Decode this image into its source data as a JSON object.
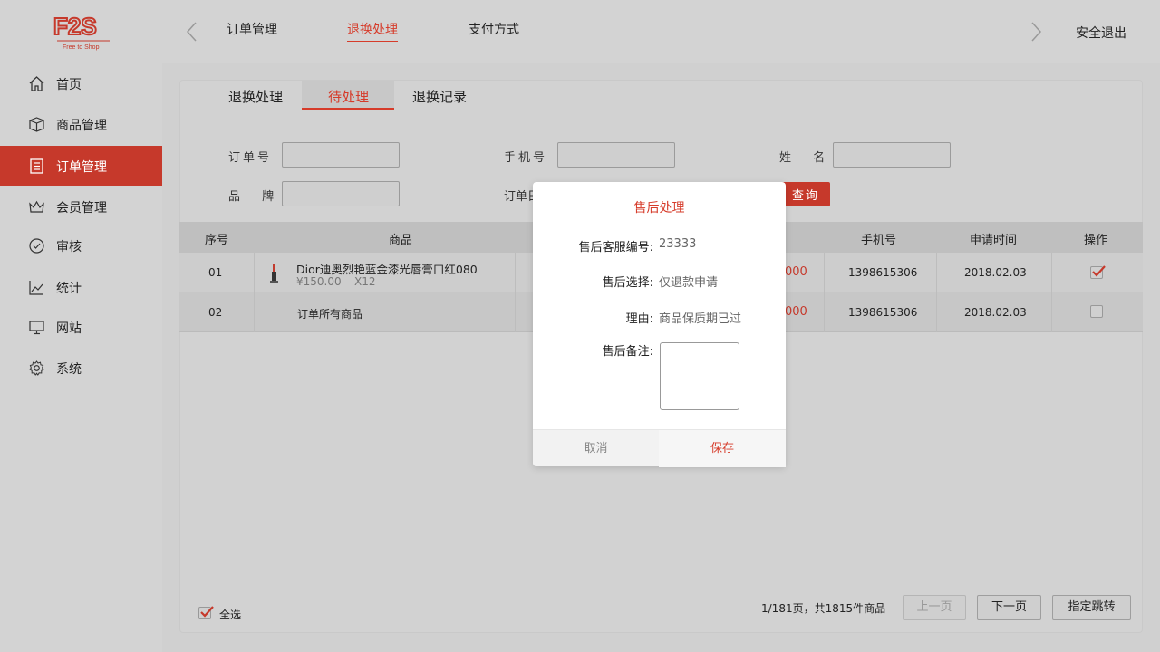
{
  "brand": {
    "logo_text": "F2S",
    "logo_subtitle": "Free to Shop",
    "accent": "#c6392b"
  },
  "topnav": {
    "tabs": [
      {
        "label": "订单管理"
      },
      {
        "label": "退换处理",
        "active": true
      },
      {
        "label": "支付方式"
      }
    ],
    "logout": "安全退出"
  },
  "sidebar": {
    "items": [
      {
        "label": "首页",
        "icon": "home-icon"
      },
      {
        "label": "商品管理",
        "icon": "box-icon"
      },
      {
        "label": "订单管理",
        "icon": "document-icon",
        "active": true
      },
      {
        "label": "会员管理",
        "icon": "crown-icon"
      },
      {
        "label": "审核",
        "icon": "check-circle-icon"
      },
      {
        "label": "统计",
        "icon": "line-chart-icon"
      },
      {
        "label": "网站",
        "icon": "monitor-icon"
      },
      {
        "label": "系统",
        "icon": "gear-icon"
      }
    ]
  },
  "subtabs": [
    {
      "label": "退换处理"
    },
    {
      "label": "待处理",
      "active": true
    },
    {
      "label": "退换记录"
    }
  ],
  "filters": {
    "order_no": "订单号",
    "phone": "手机号",
    "name": "姓 名",
    "brand": "品 牌",
    "order_date": "订单日",
    "query": "查询"
  },
  "table": {
    "headers": [
      "序号",
      "商品",
      "手机号",
      "申请时间",
      "操作"
    ],
    "rows": [
      {
        "no": "01",
        "product": "Dior迪奥烈艳蓝金漆光唇膏口红080",
        "price": "¥150.00",
        "qty": "X12",
        "amount": "000",
        "phone": "1398615306",
        "date": "2018.02.03",
        "checked": true
      },
      {
        "no": "02",
        "product": "订单所有商品",
        "amount": "000",
        "phone": "1398615306",
        "date": "2018.02.03",
        "checked": false
      }
    ]
  },
  "footer": {
    "select_all": "全选",
    "page_info": "1/181页，共1815件商品",
    "prev": "上一页",
    "next": "下一页",
    "jump": "指定跳转"
  },
  "modal": {
    "title": "售后处理",
    "fields": [
      {
        "label": "售后客服编号:",
        "value": "23333"
      },
      {
        "label": "售后选择:",
        "value": "仅退款申请"
      },
      {
        "label": "理由:",
        "value": "商品保质期已过"
      }
    ],
    "note_label": "售后备注:",
    "note_value": "",
    "cancel": "取消",
    "save": "保存"
  }
}
